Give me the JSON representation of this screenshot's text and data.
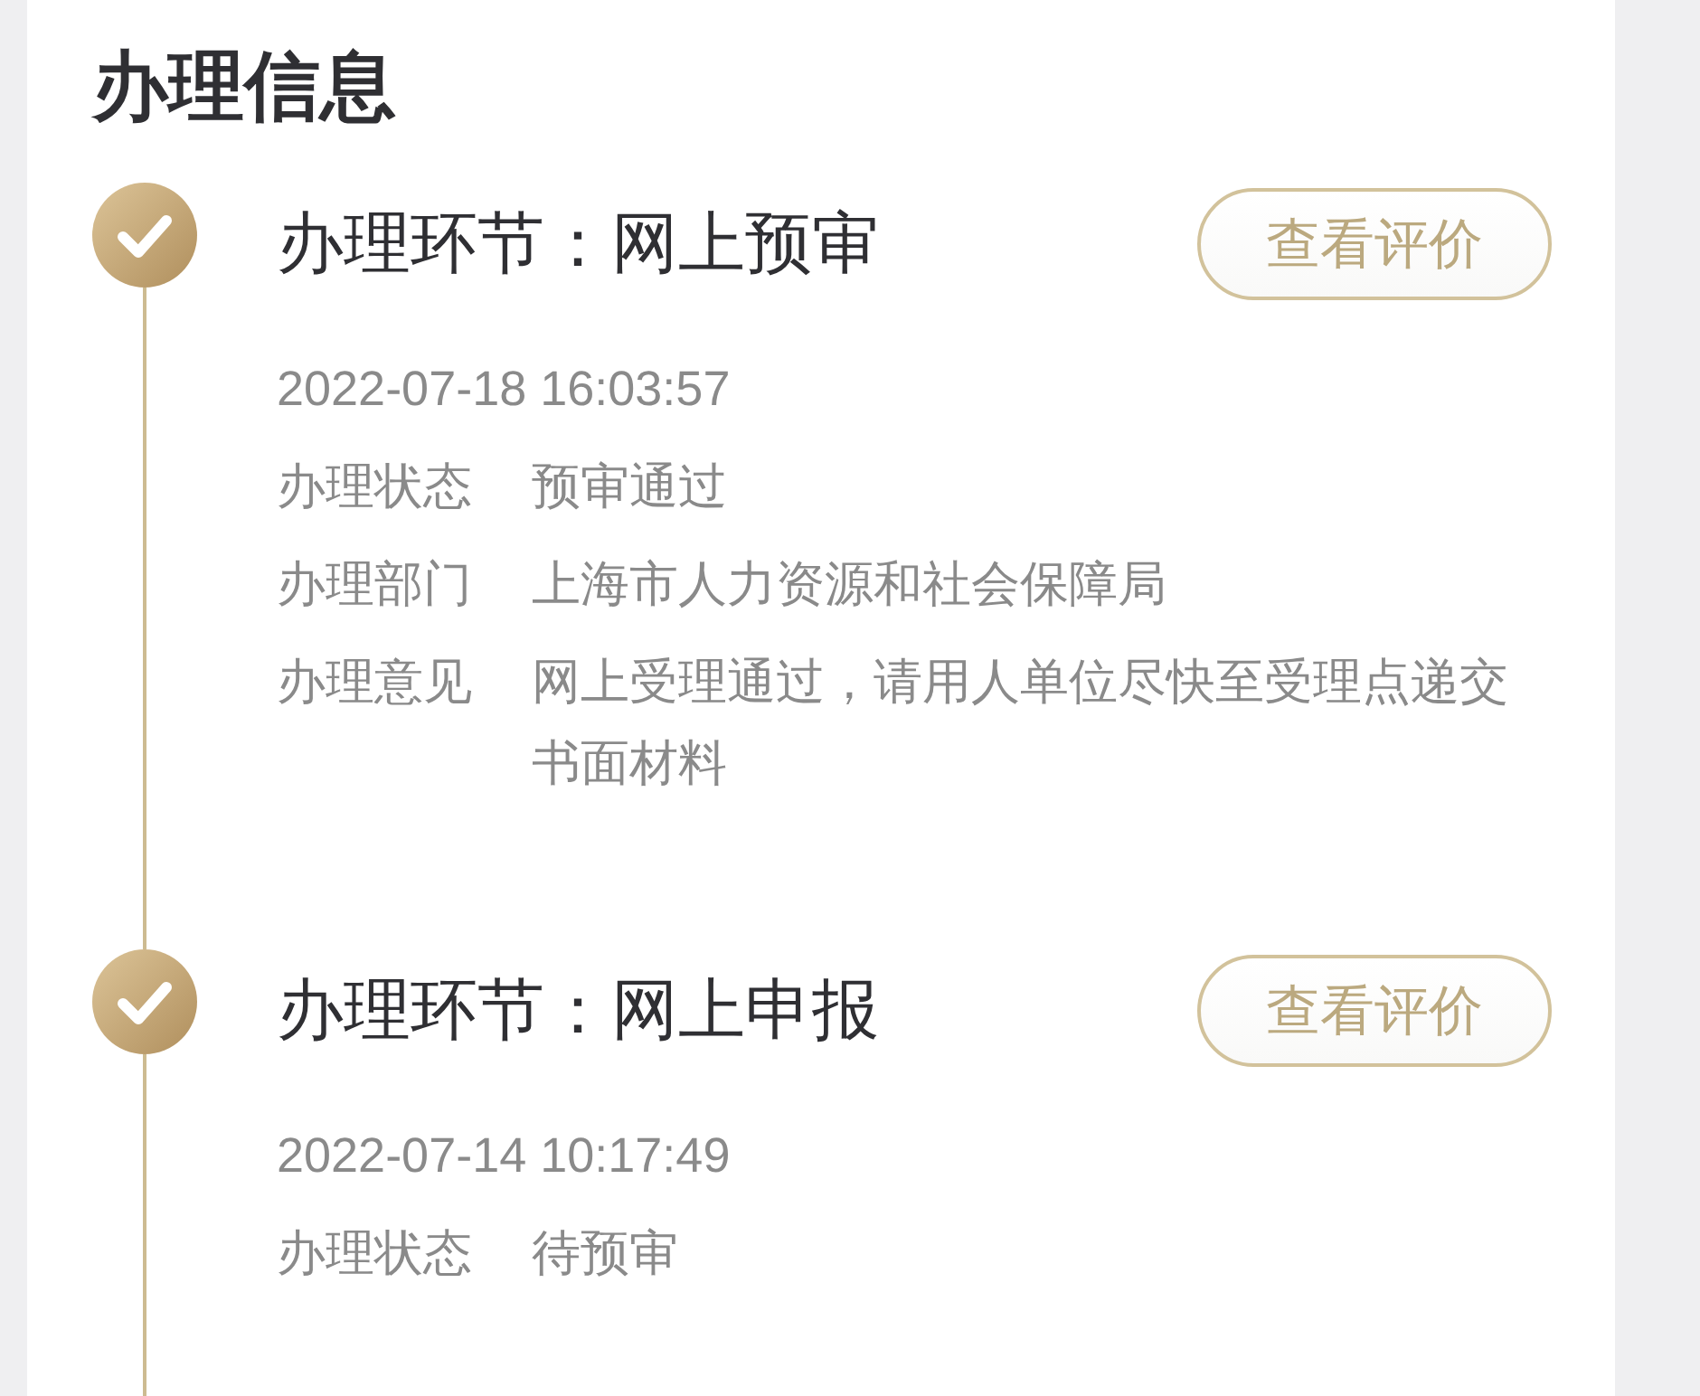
{
  "section": {
    "title": "办理信息"
  },
  "steps": [
    {
      "done": true,
      "title": "办理环节：网上预审",
      "action": "查看评价",
      "time": "2022-07-18 16:03:57",
      "details": [
        {
          "label": "办理状态",
          "value": "预审通过"
        },
        {
          "label": "办理部门",
          "value": "上海市人力资源和社会保障局"
        },
        {
          "label": "办理意见",
          "value": "网上受理通过，请用人单位尽快至受理点递交书面材料"
        }
      ]
    },
    {
      "done": true,
      "title": "办理环节：网上申报",
      "action": "查看评价",
      "time": "2022-07-14 10:17:49",
      "details": [
        {
          "label": "办理状态",
          "value": "待预审"
        }
      ]
    }
  ]
}
